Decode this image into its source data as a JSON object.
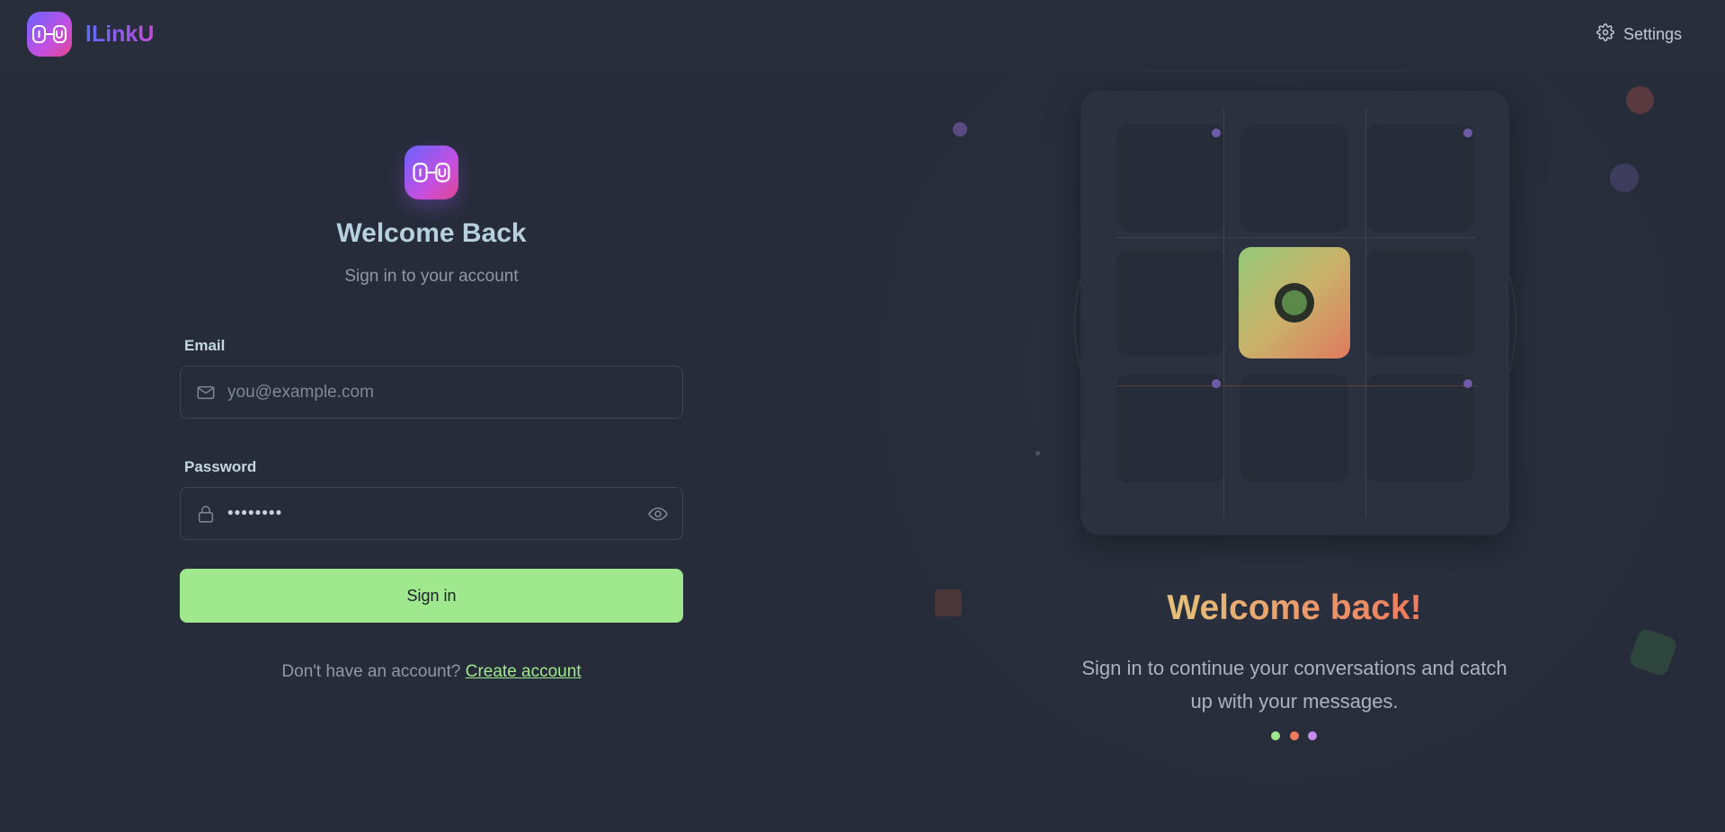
{
  "header": {
    "app_name": "lLinkU",
    "settings_label": "Settings"
  },
  "login_form": {
    "title": "Welcome Back",
    "subtitle": "Sign in to your account",
    "email": {
      "label": "Email",
      "placeholder": "you@example.com",
      "value": ""
    },
    "password": {
      "label": "Password",
      "value": "••••••••"
    },
    "submit_label": "Sign in",
    "signup_prompt": "Don't have an account?",
    "signup_link": "Create account"
  },
  "hero": {
    "title": "Welcome back!",
    "text": "Sign in to continue your conversations and catch up with your messages.",
    "dots": [
      "#a0e88d",
      "#ef7a5e",
      "#c38be6"
    ]
  },
  "colors": {
    "accent_green": "#a0e88d",
    "background": "#262c39",
    "brand_gradient_start": "#6a63ff",
    "brand_gradient_end": "#e0468f"
  }
}
